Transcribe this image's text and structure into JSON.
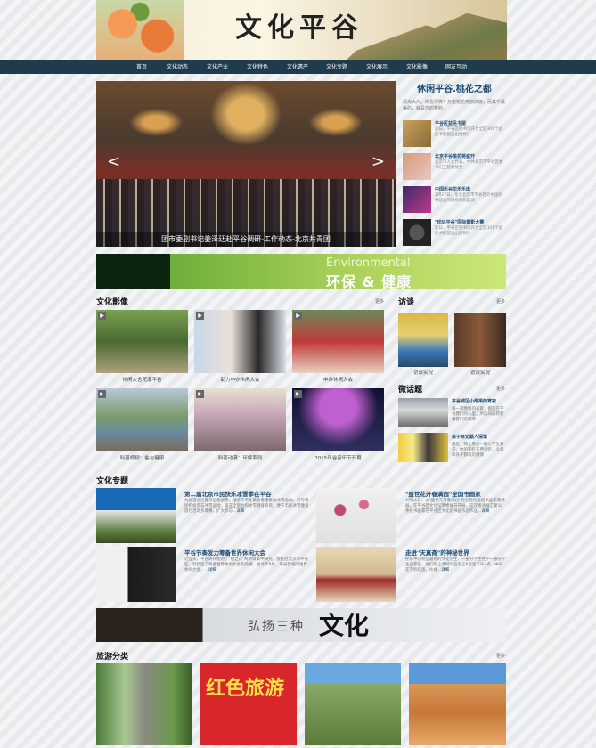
{
  "header": {
    "logo": "文化平谷"
  },
  "nav": [
    "首页",
    "文化动态",
    "文化产业",
    "文化特色",
    "文化遗产",
    "文化专题",
    "文化展示",
    "文化影像",
    "网友互动"
  ],
  "slider": {
    "caption": "团市委副书记姜泽廷赴平谷调研-工作动态-北京共青团",
    "prev": "<",
    "next": ">"
  },
  "leisure": {
    "title": "休闲平谷.桃花之都",
    "intro": "风光大片，你看得爽！万亩桃花竞放妖娆，而其中最美的，就是您的笑脸。",
    "news": [
      {
        "title": "平谷区益民书屋",
        "desc": "近日，平谷区图书馆开为全区301个益民书屋配送出版物3"
      },
      {
        "title": "北京平谷桃花将盛开",
        "desc": "北京市人大代表、中共北京市平谷区委书记王智勇接受"
      },
      {
        "title": "中国乐谷华乐乐库",
        "desc": "2月27日，位于北京市平谷区的中国乐谷建设项目有限机起调"
      },
      {
        "title": "\"印记平谷\"国际摄影大赛",
        "desc": "近日，平谷区图书馆开为全区301个益民书屋配送出版物3"
      }
    ]
  },
  "env_banner": {
    "en": "Environmental",
    "cn": "环保 & 健康"
  },
  "culture_images": {
    "title": "文化影像",
    "more": "更多",
    "items": [
      {
        "caption": "休闲大舍花溪平谷"
      },
      {
        "caption": "助力申办休闲大会"
      },
      {
        "caption": "申办休闲大会"
      },
      {
        "caption": "科普视频：盐与健康"
      },
      {
        "caption": "科普动漫：环保系列"
      },
      {
        "caption": "2015乐谷音乐节开幕"
      }
    ]
  },
  "interview": {
    "title": "访谈",
    "more": "更多",
    "items": [
      {
        "caption": "访谈实况"
      },
      {
        "caption": "访谈实况"
      }
    ]
  },
  "micro": {
    "title": "微话题",
    "more": "更多",
    "items": [
      {
        "title": "平谷城区小南渠的宵夜",
        "desc": "每一次晚饭的农家，都是在平谷我们的心里，所信同的政客乘客们的城市"
      },
      {
        "title": "孩子目记敲人深谁",
        "desc": "最近，网上看过一篇小学生日记，他的不吃东西话吃，父母和孩子都说的激情"
      }
    ]
  },
  "topics": {
    "title": "文化专题",
    "items": [
      {
        "title": "第二届北京市民快乐冰雪季在平谷",
        "desc": "为加强全民健身国家战略，推进京市冬奥会筹建推动冰雪运动，引导市民积极参与冰雪运动，第五全面合和冰雪健身等目，便于市民冰雪健身旅行活动多摩赛，扩大参与..."
      },
      {
        "title": "\"盛世花开春满园\"全国书画家",
        "desc": "4月15日，以\"盛世花开春满园\"为主题的全国书画家邀请展，在平谷区文化馆两楼展开开展，这次邀请展汇聚50余名书画家在平谷区文化馆书画作品作品..."
      },
      {
        "title": "平谷节奏发力筹备世界休闲大会",
        "desc": "近些天，平谷期开始对了\"镜之花\"两项目集中研究，接批社北京市平谷区，到新区了筹备世界休闲大会的热潮，总达年8月，平谷营将同世界休闲大会，..."
      },
      {
        "title": "走进\"天真斋\"的神秘世界",
        "desc": "把乐中心有些最有的文化学生，一部分学生住学一部分学生回家住，他们的上课时间是早上8点至下午4点，中午在学校吃饭，伙食..."
      }
    ],
    "more_link": "详细"
  },
  "wenhua_banner": {
    "text": "弘扬三种",
    "big": "文化"
  },
  "tourism": {
    "title": "旅游分类",
    "more": "更多",
    "hongse": "红色旅游"
  }
}
